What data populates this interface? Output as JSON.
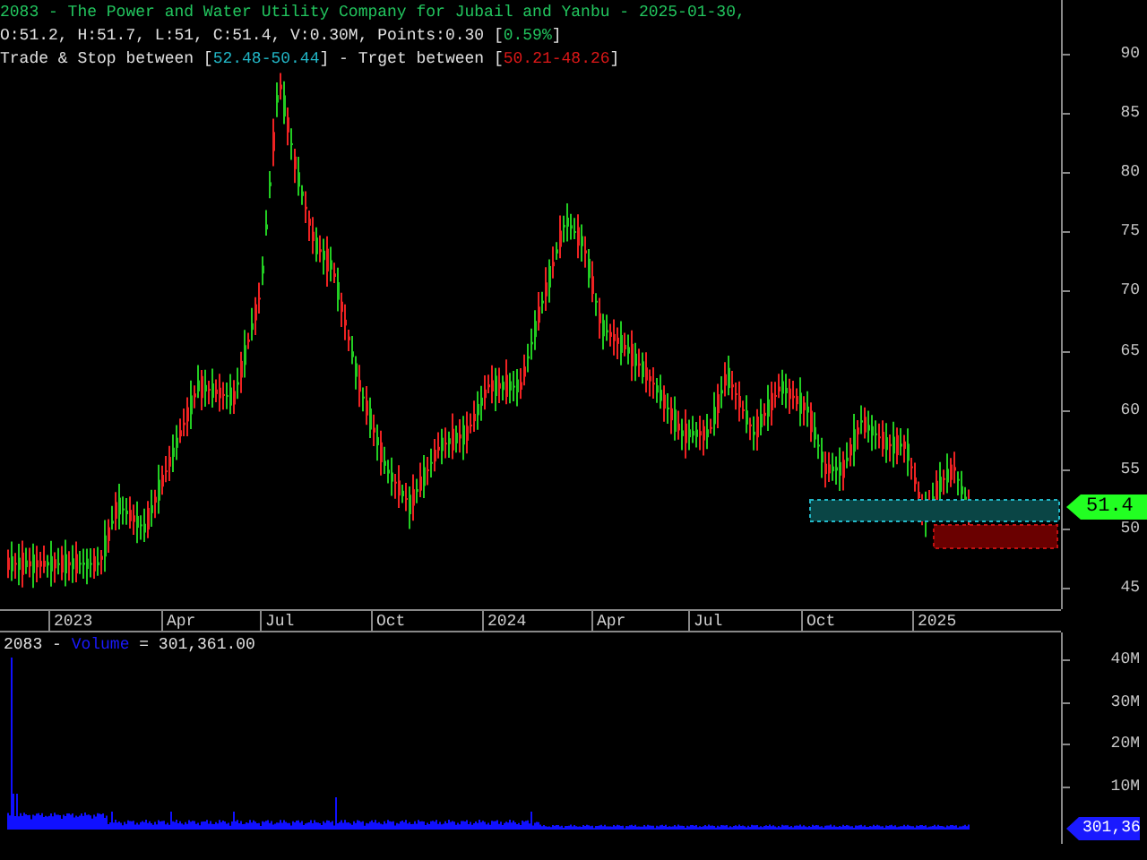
{
  "legend": {
    "title": "2083 - The Power and Water Utility Company for Jubail and Yanbu - 2025-01-30,",
    "lines": [
      [
        {
          "text": "O:51.2, H:51.7, L:51, C:51.4, V:0.30M, Points:0.30 [",
          "kind": "plain"
        },
        {
          "text": "0.59%",
          "kind": "up"
        },
        {
          "text": "]",
          "kind": "plain"
        }
      ],
      [
        {
          "text": "Trade & Stop between [",
          "kind": "plain"
        },
        {
          "text": "52.48-50.44",
          "kind": "cyan"
        },
        {
          "text": "] - Trget between [",
          "kind": "plain"
        },
        {
          "text": "50.21-48.26",
          "kind": "down"
        },
        {
          "text": "]",
          "kind": "plain"
        }
      ]
    ]
  },
  "price_axis": {
    "ticks": [
      "90",
      "85",
      "80",
      "75",
      "70",
      "65",
      "60",
      "55",
      "50",
      "45"
    ],
    "last_price": "51.4"
  },
  "date_axis": [
    "2023",
    "Apr",
    "Jul",
    "Oct",
    "2024",
    "Apr",
    "Jul",
    "Oct",
    "2025"
  ],
  "volume_panel": {
    "legend": [
      {
        "text": "2083 - ",
        "kind": "plain"
      },
      {
        "text": "Volume",
        "kind": "blue"
      },
      {
        "text": " = 301,361.00",
        "kind": "plain"
      }
    ],
    "ticks": [
      "40M",
      "30M",
      "20M",
      "10M"
    ],
    "last_volume": "301,36"
  }
}
